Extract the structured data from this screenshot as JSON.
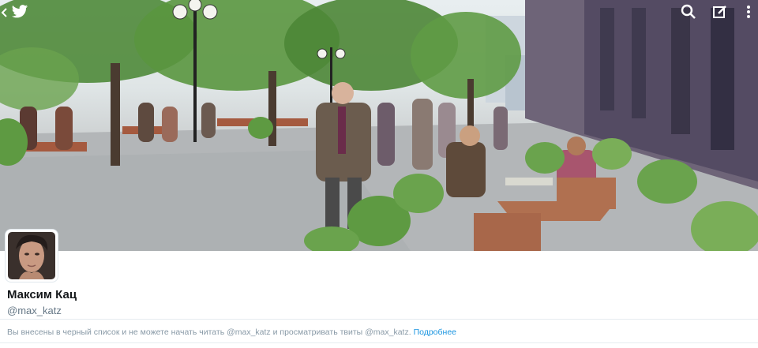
{
  "header": {
    "back_icon": "chevron-left-icon",
    "logo_icon": "twitter-bird-icon",
    "actions": [
      {
        "icon": "search-icon"
      },
      {
        "icon": "compose-icon"
      },
      {
        "icon": "more-vertical-icon"
      }
    ]
  },
  "banner": {
    "description_colors": {
      "sky": "#e8eef0",
      "foliage": "#4f8a3a",
      "pavement": "#b9babb",
      "building": "#5a4f6e"
    }
  },
  "profile": {
    "name": "Максим Кац",
    "handle": "@max_katz"
  },
  "notice": {
    "text": "Вы внесены в черный список и не можете начать читать @max_katz и просматривать твиты @max_katz. ",
    "link_label": "Подробнее"
  },
  "colors": {
    "link": "#1b95e0",
    "name": "#14171a",
    "secondary_text": "#657786",
    "notice_text": "#8899a6"
  }
}
